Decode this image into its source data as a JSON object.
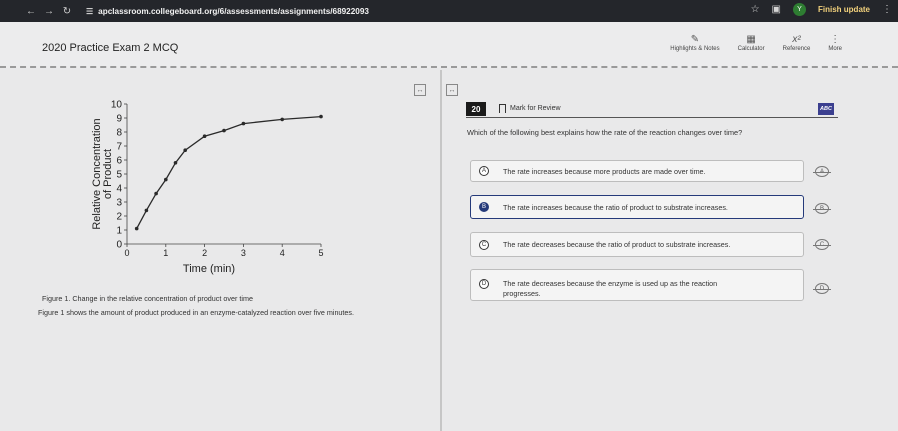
{
  "browser": {
    "url": "apclassroom.collegeboard.org/6/assessments/assignments/68922093",
    "finish_label": "Finish update",
    "avatar_letter": "Y"
  },
  "exam": {
    "title": "2020 Practice Exam 2 MCQ",
    "tools": [
      {
        "label": "Highlights & Notes",
        "icon": "highlight-icon"
      },
      {
        "label": "Calculator",
        "icon": "calculator-icon"
      },
      {
        "label": "Reference",
        "icon": "reference-icon"
      },
      {
        "label": "More",
        "icon": "more-icon"
      }
    ]
  },
  "stimulus": {
    "caption": "Figure 1. Change in the relative concentration of product over time",
    "description": "Figure 1 shows the amount of product produced in an enzyme-catalyzed reaction over five minutes."
  },
  "chart_data": {
    "type": "line",
    "xlabel": "Time (min)",
    "ylabel": "Relative Concentration of Product",
    "xlim": [
      0,
      5
    ],
    "ylim": [
      0,
      10
    ],
    "x_ticks": [
      0,
      1,
      2,
      3,
      4,
      5
    ],
    "y_ticks": [
      0,
      1,
      2,
      3,
      4,
      5,
      6,
      7,
      8,
      9,
      10
    ],
    "x": [
      0.25,
      0.5,
      0.75,
      1.0,
      1.25,
      1.5,
      2.0,
      2.5,
      3.0,
      4.0,
      5.0
    ],
    "y": [
      1.1,
      2.4,
      3.6,
      4.6,
      5.8,
      6.7,
      7.7,
      8.1,
      8.6,
      8.9,
      9.1
    ],
    "grid": false,
    "color": "#2a2a2a"
  },
  "question": {
    "number": "20",
    "mark_label": "Mark for Review",
    "abc_label": "ABC",
    "text": "Which of the following best explains how the rate of the reaction changes over time?",
    "selected": "B",
    "options": [
      {
        "letter": "A",
        "text": "The rate increases because more products are made over time."
      },
      {
        "letter": "B",
        "text": "The rate increases because the ratio of product to substrate increases."
      },
      {
        "letter": "C",
        "text": "The rate decreases because the ratio of product to substrate increases."
      },
      {
        "letter": "D",
        "text": "The rate decreases because the enzyme is used up as the reaction progresses."
      }
    ]
  }
}
